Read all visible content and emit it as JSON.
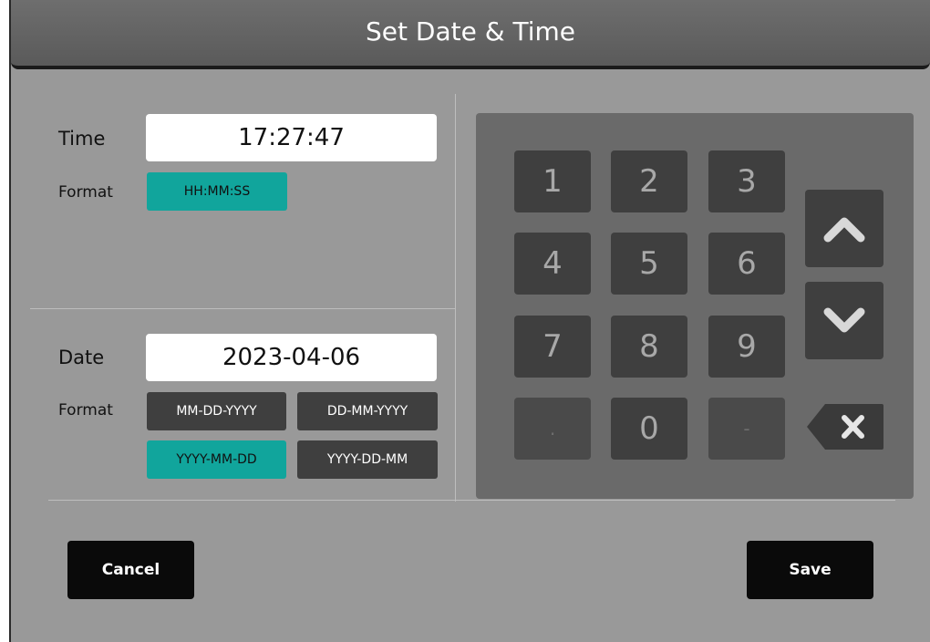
{
  "window": {
    "title": "Set Date & Time"
  },
  "time": {
    "label": "Time",
    "value": "17:27:47",
    "format_label": "Format",
    "formats": [
      {
        "label": "HH:MM:SS",
        "selected": true
      }
    ]
  },
  "date": {
    "label": "Date",
    "value": "2023-04-06",
    "format_label": "Format",
    "formats": [
      {
        "label": "MM-DD-YYYY",
        "selected": false
      },
      {
        "label": "DD-MM-YYYY",
        "selected": false
      },
      {
        "label": "YYYY-MM-DD",
        "selected": true
      },
      {
        "label": "YYYY-DD-MM",
        "selected": false
      }
    ]
  },
  "keypad": {
    "keys": [
      "1",
      "2",
      "3",
      "4",
      "5",
      "6",
      "7",
      "8",
      "9",
      ".",
      "0",
      "-"
    ],
    "icons": {
      "up": "chevron-up-icon",
      "down": "chevron-down-icon",
      "backspace": "backspace-icon"
    }
  },
  "buttons": {
    "cancel": "Cancel",
    "save": "Save"
  },
  "colors": {
    "accent": "#11a59c",
    "key_bg": "#3f3f3f",
    "panel_bg": "#999999",
    "titlebar": "#5f5f5f"
  }
}
